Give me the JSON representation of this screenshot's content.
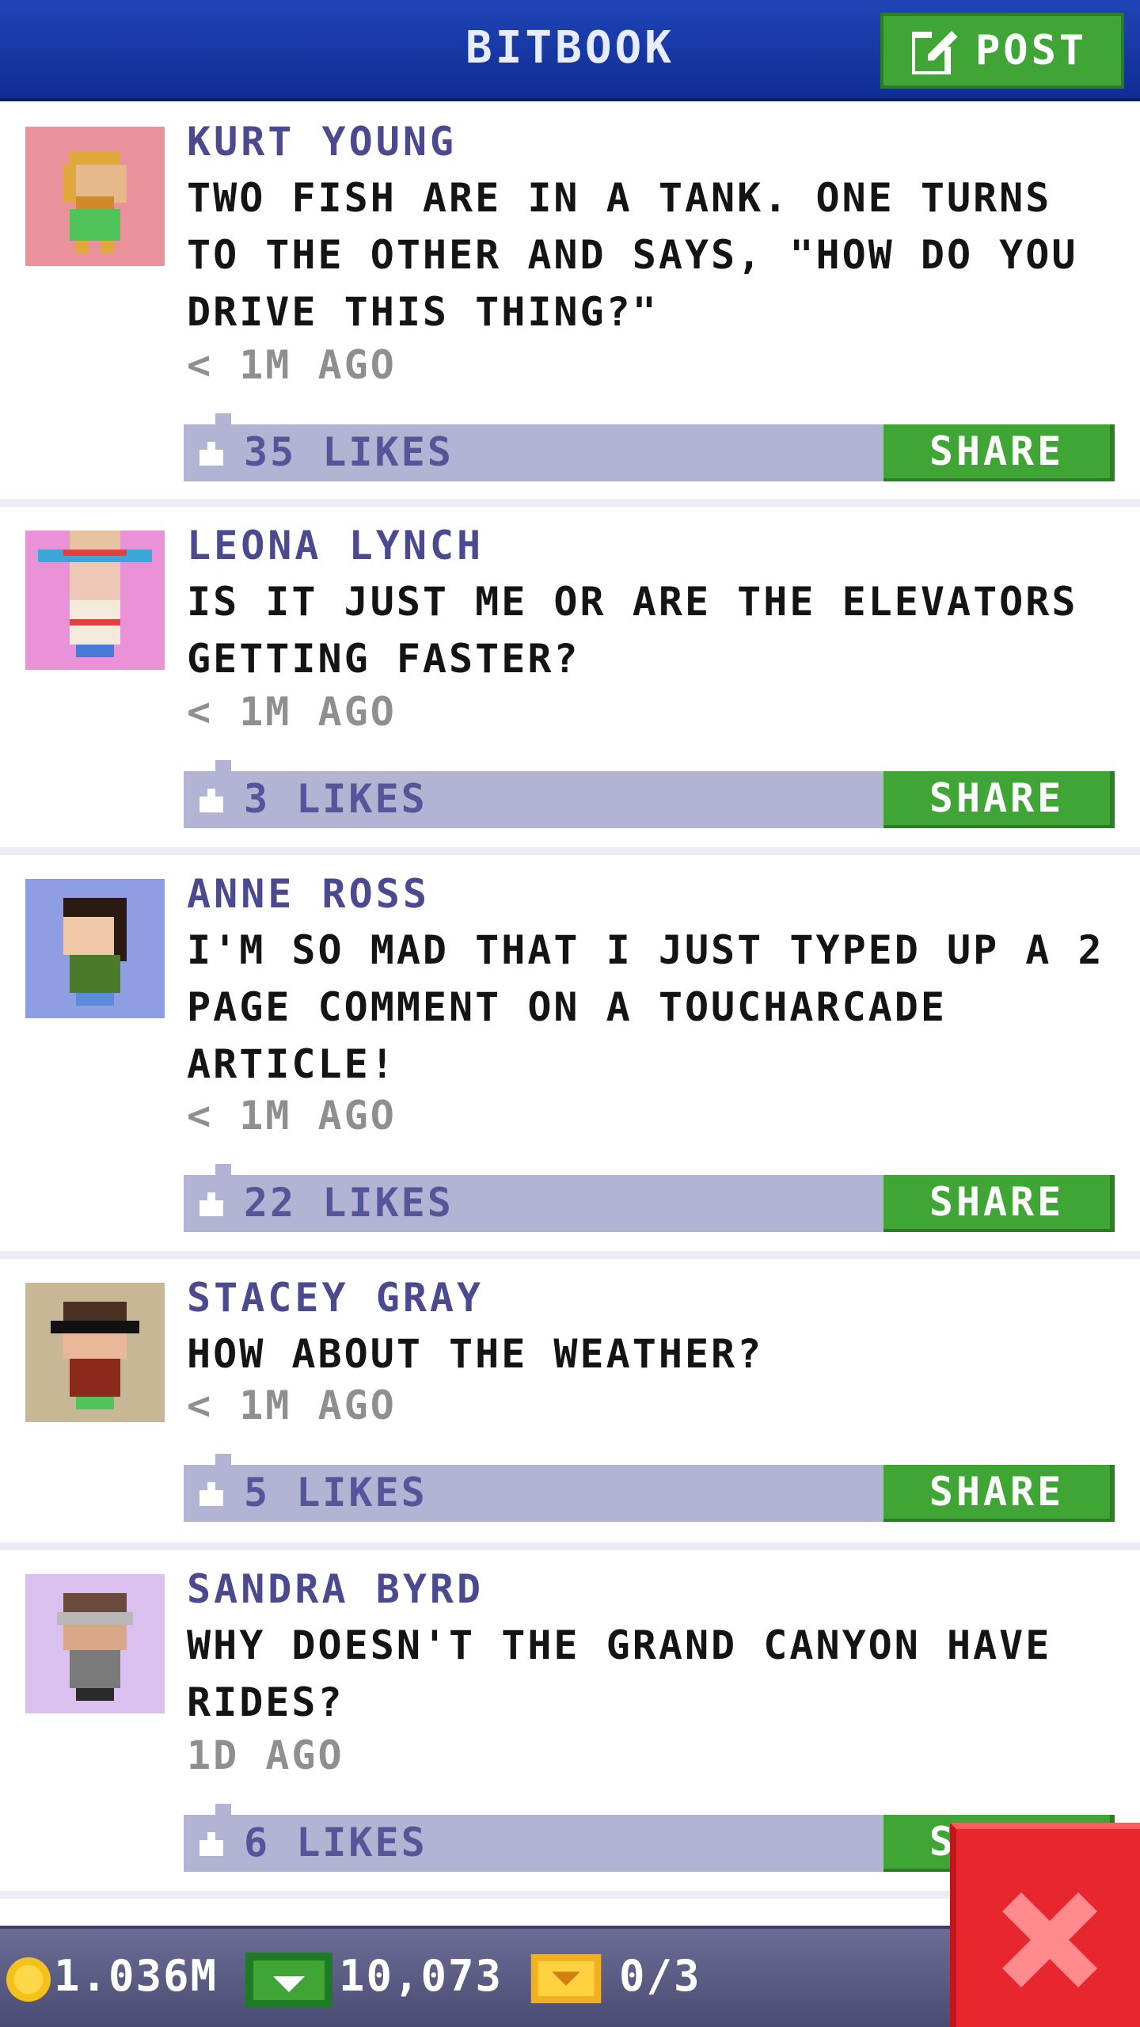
{
  "header": {
    "title": "BITBOOK",
    "post_label": "POST"
  },
  "posts": [
    {
      "author": "KURT YOUNG",
      "message": "TWO FISH ARE IN A TANK. ONE TURNS TO THE OTHER AND SAYS, \"HOW DO YOU DRIVE THIS THING?\"",
      "time": "< 1M AGO",
      "likes": "35 LIKES",
      "share": "SHARE",
      "avatar_bg": "#e9929c"
    },
    {
      "author": "LEONA LYNCH",
      "message": "IS IT JUST ME OR ARE THE ELEVATORS GETTING FASTER?",
      "time": "< 1M AGO",
      "likes": "3 LIKES",
      "share": "SHARE",
      "avatar_bg": "#ea92d8"
    },
    {
      "author": "ANNE ROSS",
      "message": "I'M SO MAD THAT I JUST TYPED UP A 2 PAGE COMMENT ON A TOUCHARCADE ARTICLE!",
      "time": "< 1M AGO",
      "likes": "22 LIKES",
      "share": "SHARE",
      "avatar_bg": "#8f9ee2"
    },
    {
      "author": "STACEY GRAY",
      "message": "HOW ABOUT THE WEATHER?",
      "time": "< 1M AGO",
      "likes": "5 LIKES",
      "share": "SHARE",
      "avatar_bg": "#c8b795"
    },
    {
      "author": "SANDRA BYRD",
      "message": "WHY DOESN'T THE GRAND CANYON HAVE RIDES?",
      "time": "1D AGO",
      "likes": "6 LIKES",
      "share": "SHARE",
      "avatar_bg": "#d9c0ee"
    }
  ],
  "status_bar": {
    "coins": "1.036M",
    "bux": "10,073",
    "tickets": "0/3"
  },
  "colors": {
    "header": "#1f44b6",
    "accent_green": "#3fa534",
    "likes_bar": "#b3b3d3",
    "author": "#4b4a90",
    "close": "#e8262d"
  },
  "icons": {
    "post": "edit-icon",
    "like": "thumbs-up-icon",
    "coin": "coin-icon",
    "bux": "cash-icon",
    "ticket": "ticket-icon",
    "close": "close-icon"
  }
}
